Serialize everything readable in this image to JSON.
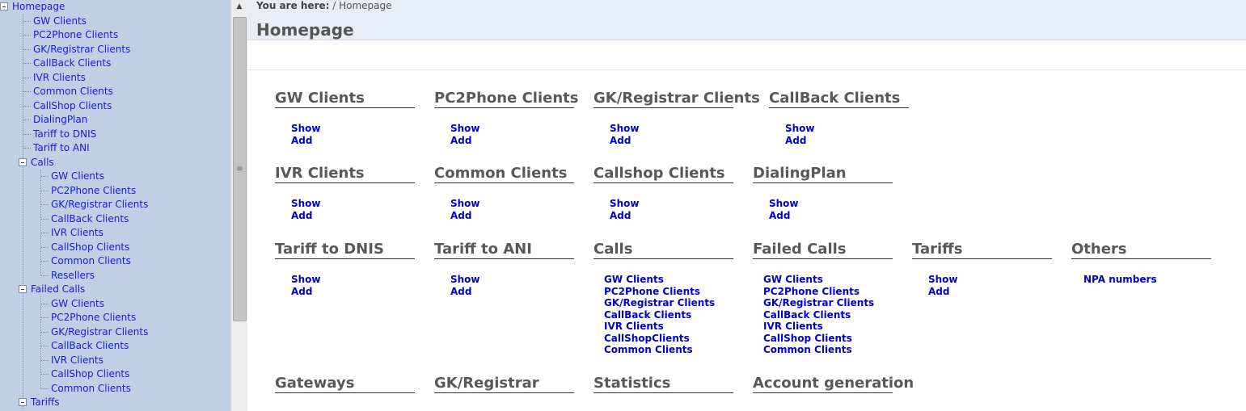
{
  "tree": {
    "root": "Homepage",
    "items": [
      "GW Clients",
      "PC2Phone Clients",
      "GK/Registrar Clients",
      "CallBack Clients",
      "IVR Clients",
      "Common Clients",
      "CallShop Clients",
      "DialingPlan",
      "Tariff to DNIS",
      "Tariff to ANI"
    ],
    "calls": {
      "label": "Calls",
      "children": [
        "GW Clients",
        "PC2Phone Clients",
        "GK/Registrar Clients",
        "CallBack Clients",
        "IVR Clients",
        "CallShop Clients",
        "Common Clients",
        "Resellers"
      ]
    },
    "failed_calls": {
      "label": "Failed Calls",
      "children": [
        "GW Clients",
        "PC2Phone Clients",
        "GK/Registrar Clients",
        "CallBack Clients",
        "IVR Clients",
        "CallShop Clients",
        "Common Clients"
      ]
    },
    "tariffs": {
      "label": "Tariffs"
    }
  },
  "scrollbar": {
    "up_arrow": "▲",
    "grip": "≡"
  },
  "header": {
    "breadcrumb_label": "You are here:",
    "breadcrumb_path": "/ Homepage",
    "title": "Homepage"
  },
  "sections": {
    "gw_clients": {
      "title": "GW Clients",
      "links": [
        "Show",
        "Add"
      ]
    },
    "pc2phone_clients": {
      "title": "PC2Phone Clients",
      "links": [
        "Show",
        "Add"
      ]
    },
    "gk_clients": {
      "title": "GK/Registrar Clients",
      "links": [
        "Show",
        "Add"
      ]
    },
    "callback_clients": {
      "title": "CallBack Clients",
      "links": [
        "Show",
        "Add"
      ]
    },
    "ivr_clients": {
      "title": "IVR Clients",
      "links": [
        "Show",
        "Add"
      ]
    },
    "common_clients": {
      "title": "Common Clients",
      "links": [
        "Show",
        "Add"
      ]
    },
    "callshop_clients": {
      "title": "Callshop Clients",
      "links": [
        "Show",
        "Add"
      ]
    },
    "dialingplan": {
      "title": "DialingPlan",
      "links": [
        "Show",
        "Add"
      ]
    },
    "tariff_dnis": {
      "title": "Tariff to DNIS",
      "links": [
        "Show",
        "Add"
      ]
    },
    "tariff_ani": {
      "title": "Tariff to ANI",
      "links": [
        "Show",
        "Add"
      ]
    },
    "calls": {
      "title": "Calls",
      "links": [
        "GW Clients",
        "PC2Phone Clients",
        "GK/Registrar Clients",
        "CallBack Clients",
        "IVR Clients",
        "CallShopClients",
        "Common Clients"
      ]
    },
    "failed_calls": {
      "title": "Failed Calls",
      "links": [
        "GW Clients",
        "PC2Phone Clients",
        "GK/Registrar Clients",
        "CallBack Clients",
        "IVR Clients",
        "CallShop Clients",
        "Common Clients"
      ]
    },
    "tariffs": {
      "title": "Tariffs",
      "links": [
        "Show",
        "Add"
      ]
    },
    "others": {
      "title": "Others",
      "links": [
        "NPA numbers"
      ]
    },
    "gateways": {
      "title": "Gateways"
    },
    "gk_registrar": {
      "title": "GK/Registrar"
    },
    "statistics": {
      "title": "Statistics"
    },
    "account_generation": {
      "title": "Account generation"
    }
  }
}
